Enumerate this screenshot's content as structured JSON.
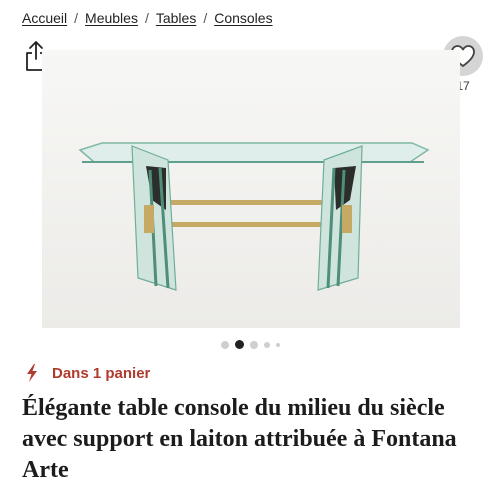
{
  "breadcrumb": {
    "items": [
      "Accueil",
      "Meubles",
      "Tables",
      "Consoles"
    ],
    "separator": "/"
  },
  "share": {
    "icon": "share-icon"
  },
  "favorite": {
    "icon": "heart-icon",
    "count": "17"
  },
  "gallery": {
    "dot_count": 5,
    "active_index": 1
  },
  "cart_status": {
    "icon": "lightning-icon",
    "text": "Dans 1 panier",
    "color": "#b03a2e"
  },
  "product": {
    "title": "Élégante table console du milieu du siècle avec support en laiton attribuée à Fontana Arte"
  }
}
